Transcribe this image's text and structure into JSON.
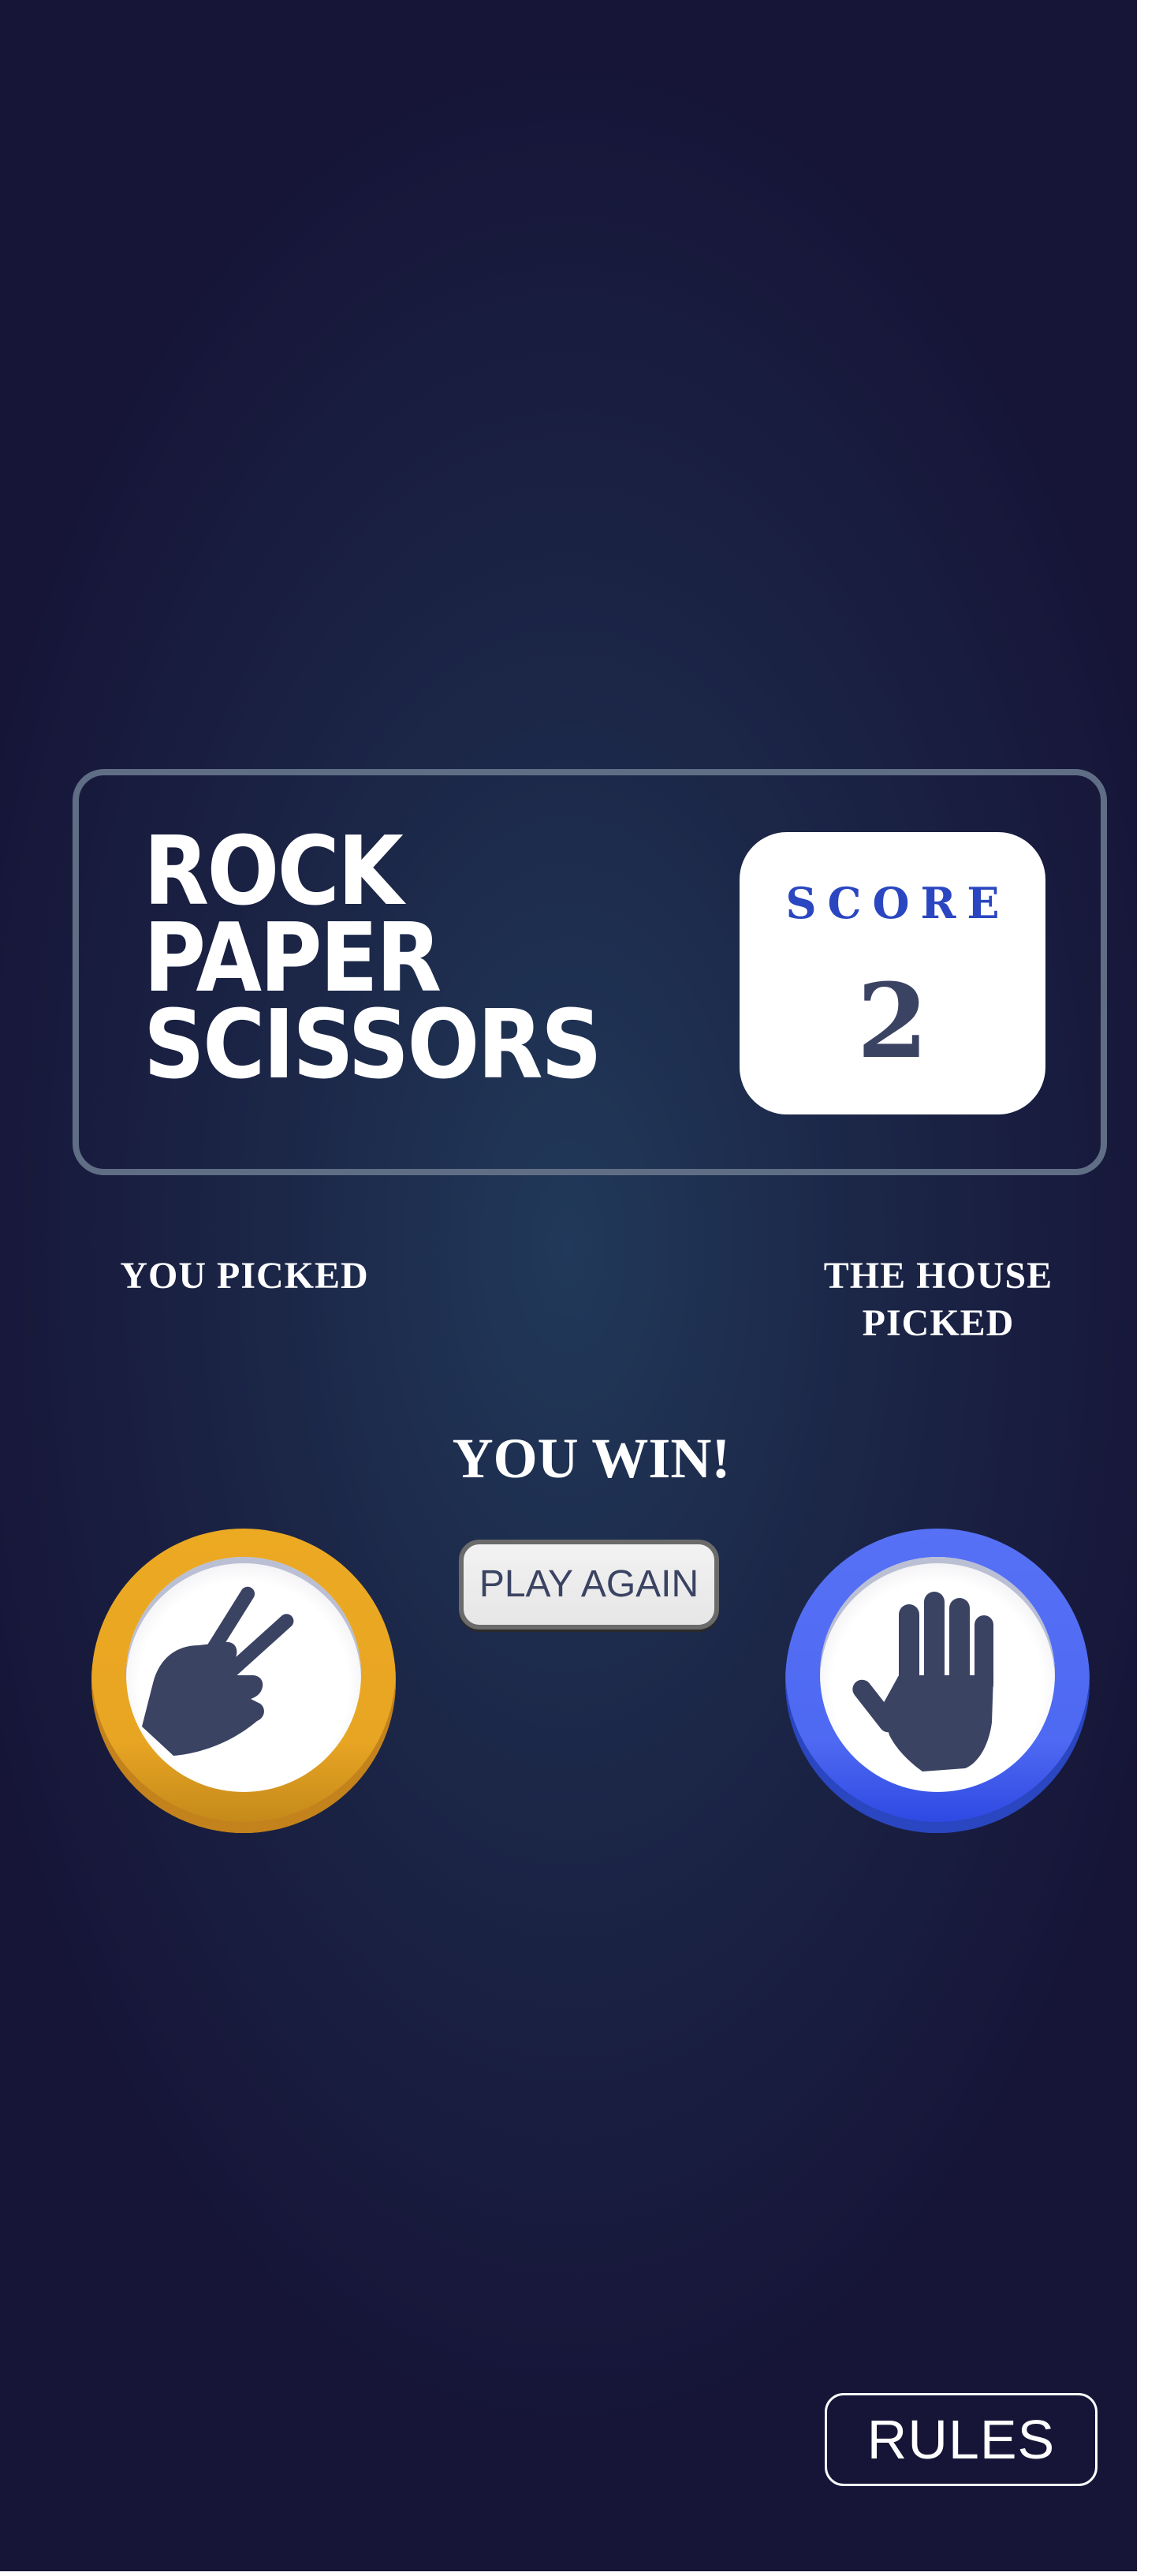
{
  "header": {
    "title_lines": [
      "ROCK",
      "PAPER",
      "SCISSORS"
    ],
    "score_label": "SCORE",
    "score_value": "2"
  },
  "game": {
    "you_picked_label": "YOU PICKED",
    "house_picked_label": "THE HOUSE PICKED",
    "result_text": "YOU WIN!",
    "play_again_label": "PLAY AGAIN",
    "player_choice": "scissors",
    "house_choice": "paper"
  },
  "footer": {
    "rules_label": "RULES"
  },
  "colors": {
    "scissors_ring": "#eca922",
    "paper_ring": "#5671f5",
    "score_label": "#2a46c0",
    "dark_text": "#3b4363",
    "header_outline": "#606e85"
  },
  "icons": {
    "player_token_icon": "scissors-icon",
    "house_token_icon": "paper-icon"
  }
}
